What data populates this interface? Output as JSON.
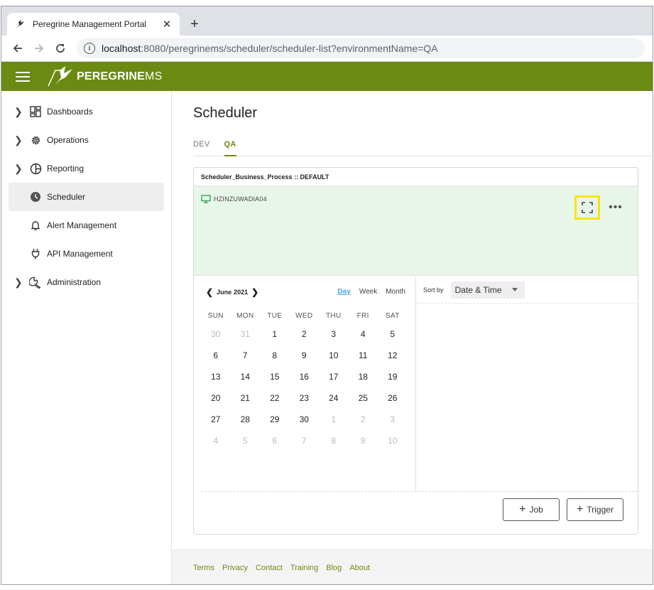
{
  "browser": {
    "tab_title": "Peregrine Management Portal",
    "new_tab_symbol": "+",
    "close_symbol": "✕",
    "url_host": "localhost",
    "url_rest": ":8080/peregrinems/scheduler/scheduler-list?environmentName=QA"
  },
  "app": {
    "brand_main": "PEREGRINE",
    "brand_suffix": "MS",
    "brand_color": "#6b8a12"
  },
  "sidebar": {
    "items": [
      {
        "label": "Dashboards",
        "icon": "dashboard-icon",
        "expandable": true
      },
      {
        "label": "Operations",
        "icon": "gear-icon",
        "expandable": true
      },
      {
        "label": "Reporting",
        "icon": "pie-chart-icon",
        "expandable": true
      },
      {
        "label": "Scheduler",
        "icon": "clock-icon",
        "expandable": false,
        "active": true
      },
      {
        "label": "Alert Management",
        "icon": "bell-icon",
        "expandable": false
      },
      {
        "label": "API Management",
        "icon": "plug-icon",
        "expandable": false
      },
      {
        "label": "Administration",
        "icon": "wrench-icon",
        "expandable": true
      }
    ]
  },
  "main": {
    "title": "Scheduler",
    "env_tabs": [
      {
        "label": "DEV",
        "active": false
      },
      {
        "label": "QA",
        "active": true
      }
    ]
  },
  "card": {
    "header": "Scheduler_Business_Process :: DEFAULT",
    "server_name": "HZINZUWADIA04",
    "more_symbol": "•••"
  },
  "calendar": {
    "month_label": "June",
    "year_label": "2021",
    "prev_symbol": "❮",
    "next_symbol": "❯",
    "views": [
      "Day",
      "Week",
      "Month"
    ],
    "active_view": "Day",
    "weekdays": [
      "SUN",
      "MON",
      "TUE",
      "WED",
      "THU",
      "FRI",
      "SAT"
    ],
    "weeks": [
      [
        {
          "d": "30",
          "m": true
        },
        {
          "d": "31",
          "m": true
        },
        {
          "d": "1"
        },
        {
          "d": "2"
        },
        {
          "d": "3"
        },
        {
          "d": "4"
        },
        {
          "d": "5"
        }
      ],
      [
        {
          "d": "6"
        },
        {
          "d": "7"
        },
        {
          "d": "8"
        },
        {
          "d": "9"
        },
        {
          "d": "10"
        },
        {
          "d": "11"
        },
        {
          "d": "12"
        }
      ],
      [
        {
          "d": "13"
        },
        {
          "d": "14"
        },
        {
          "d": "15"
        },
        {
          "d": "16"
        },
        {
          "d": "17"
        },
        {
          "d": "18"
        },
        {
          "d": "19"
        }
      ],
      [
        {
          "d": "20"
        },
        {
          "d": "21"
        },
        {
          "d": "22"
        },
        {
          "d": "23"
        },
        {
          "d": "24"
        },
        {
          "d": "25"
        },
        {
          "d": "26"
        }
      ],
      [
        {
          "d": "27"
        },
        {
          "d": "28"
        },
        {
          "d": "29"
        },
        {
          "d": "30"
        },
        {
          "d": "1",
          "m": true
        },
        {
          "d": "2",
          "m": true
        },
        {
          "d": "3",
          "m": true
        }
      ],
      [
        {
          "d": "4",
          "m": true
        },
        {
          "d": "5",
          "m": true
        },
        {
          "d": "6",
          "m": true
        },
        {
          "d": "7",
          "m": true
        },
        {
          "d": "8",
          "m": true
        },
        {
          "d": "9",
          "m": true
        },
        {
          "d": "10",
          "m": true
        }
      ]
    ]
  },
  "sort": {
    "label": "Sort by",
    "value": "Date & Time"
  },
  "actions": {
    "job_label": "Job",
    "trigger_label": "Trigger",
    "plus_symbol": "+"
  },
  "footer": {
    "links": [
      "Terms",
      "Privacy",
      "Contact",
      "Training",
      "Blog",
      "About"
    ]
  }
}
